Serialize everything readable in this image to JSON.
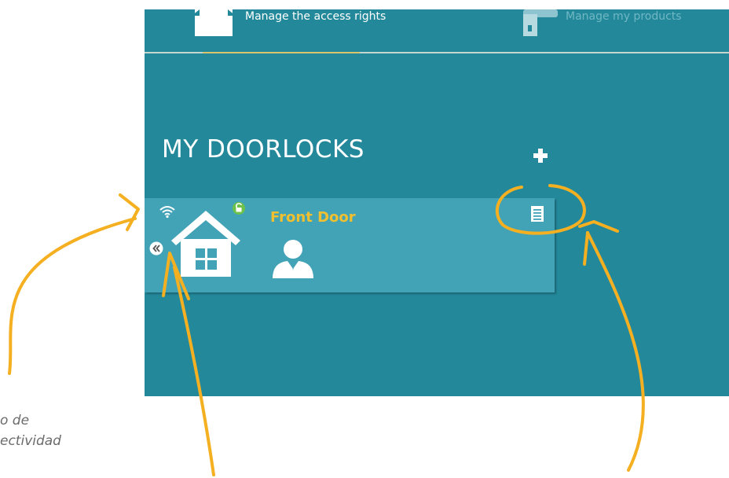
{
  "topnav": {
    "tabs": [
      {
        "label": "Manage the access rights",
        "icon": "house-icon",
        "active": true
      },
      {
        "label": "Manage my products",
        "icon": "padlock-icon",
        "active": false
      }
    ]
  },
  "main": {
    "section_title": "MY DOORLOCKS",
    "add_icon": "plus-icon"
  },
  "doorlocks": [
    {
      "name": "Front Door",
      "connectivity_icon": "wifi-icon",
      "lock_status_icon": "unlocked-padlock-icon",
      "type_icon": "house-icon",
      "user_icon": "user-icon",
      "action_icon": "document-icon",
      "collapse_icon": "double-chevron-left-icon"
    }
  ],
  "annotations": {
    "connectivity_caption": "o de\nectividad"
  },
  "colors": {
    "app_background": "#23889a",
    "card_background": "#42a3b6",
    "door_name": "#f0c030",
    "annotation": "#f5b022",
    "active_tab_underline": "#d9c46d",
    "unlocked_badge": "#6cc24a"
  }
}
